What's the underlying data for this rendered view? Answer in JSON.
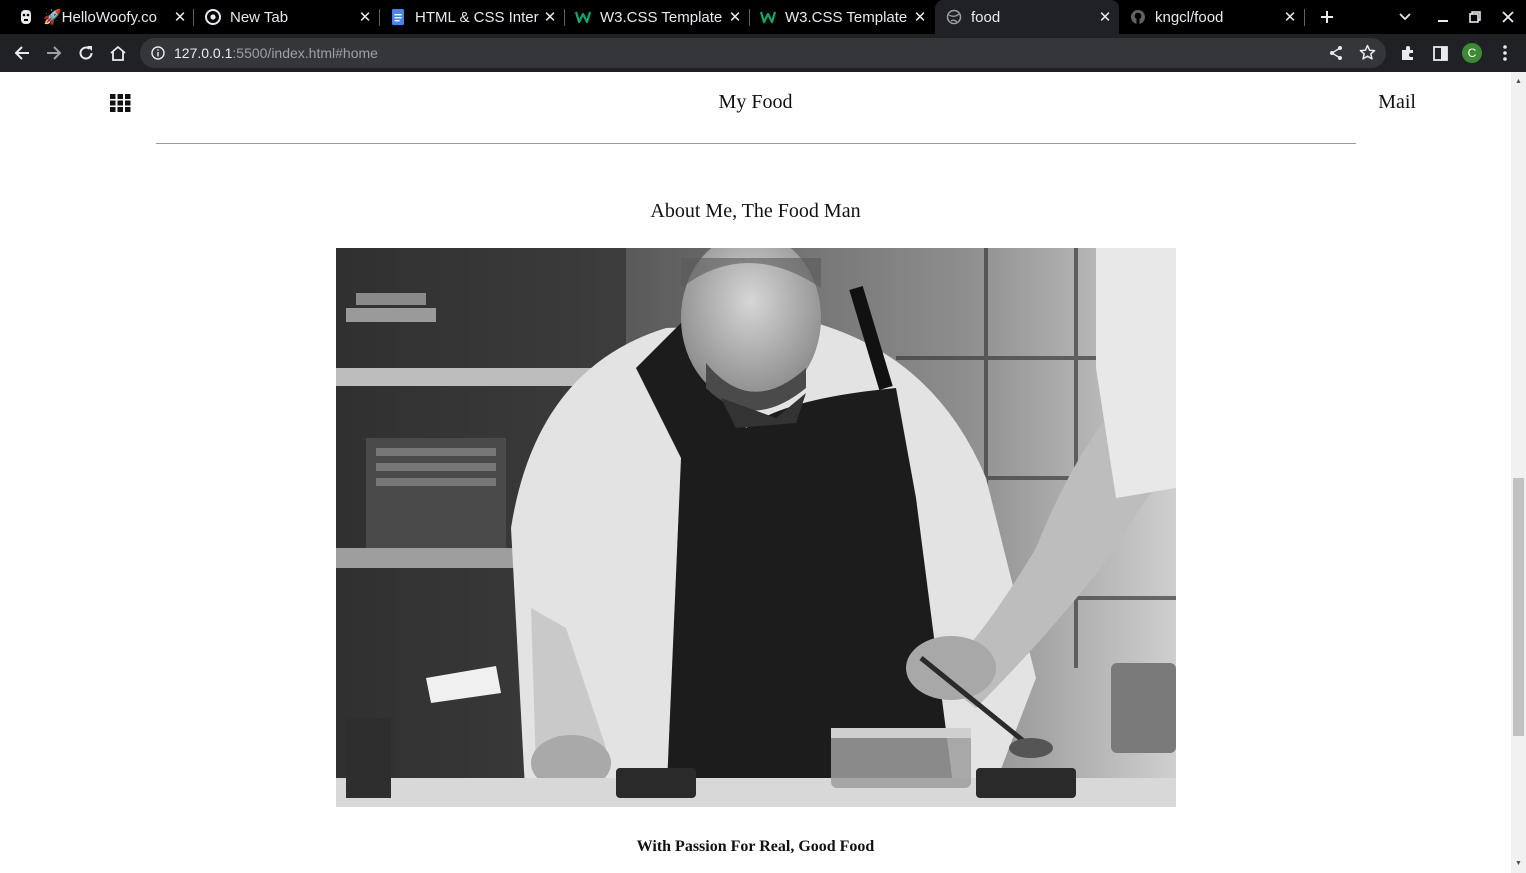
{
  "browser": {
    "tabs": [
      {
        "title": "🚀HelloWoofy.co",
        "icon": "dog-icon",
        "active": false
      },
      {
        "title": "New Tab",
        "icon": "chrome-icon",
        "active": false
      },
      {
        "title": "HTML & CSS Inter",
        "icon": "docs-icon",
        "active": false
      },
      {
        "title": "W3.CSS Template",
        "icon": "w3-icon",
        "active": false
      },
      {
        "title": "W3.CSS Template",
        "icon": "w3-icon",
        "active": false
      },
      {
        "title": "food",
        "icon": "globe-icon",
        "active": true
      },
      {
        "title": "kngcl/food",
        "icon": "github-icon",
        "active": false
      }
    ],
    "url": {
      "host": "127.0.0.1",
      "rest": ":5500/index.html#home"
    },
    "profile_initial": "C",
    "colors": {
      "tabstrip": "#000000",
      "toolbar": "#202124",
      "omnibox": "#35363a",
      "profile": "#3c8a34"
    }
  },
  "page": {
    "site_title": "My Food",
    "mail_link": "Mail",
    "about_heading": "About Me, The Food Man",
    "hero_image": "Black-and-white photo of a chef in a white jacket and dark apron plating food in a kitchen",
    "tagline": "With Passion For Real, Good Food"
  }
}
